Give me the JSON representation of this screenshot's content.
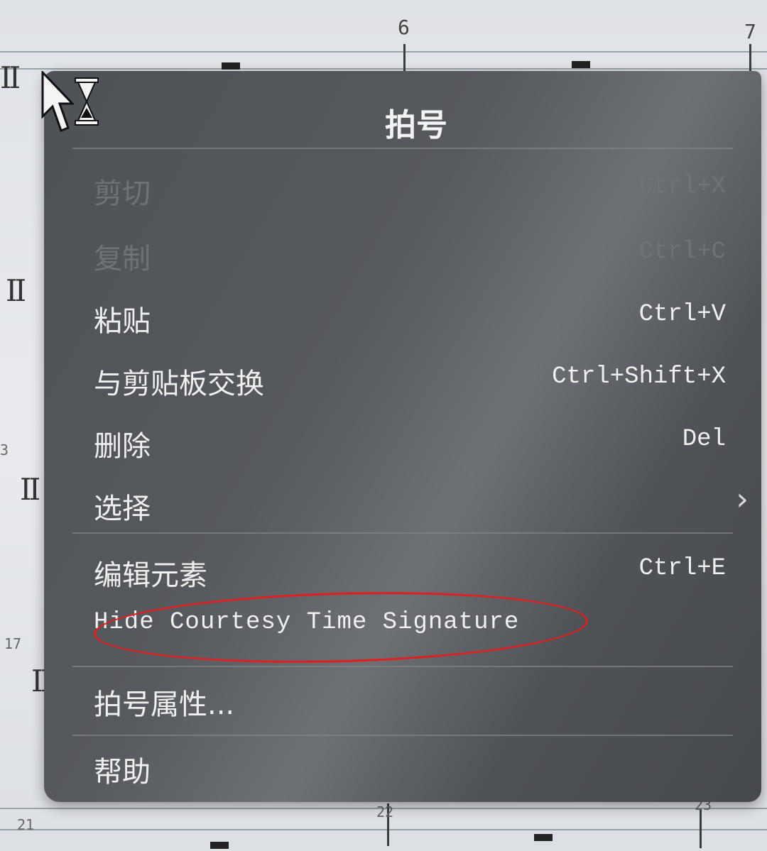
{
  "score": {
    "measure_numbers_top": [
      "6",
      "7"
    ],
    "measure_numbers_bottom": [
      "21",
      "22",
      "23"
    ],
    "left_margin_numbers": [
      "3",
      "17"
    ]
  },
  "menu": {
    "title": "拍号",
    "items": [
      {
        "label": "剪切",
        "shortcut": "Ctrl+X",
        "enabled": false
      },
      {
        "label": "复制",
        "shortcut": "Ctrl+C",
        "enabled": false
      },
      {
        "label": "粘贴",
        "shortcut": "Ctrl+V",
        "enabled": true
      },
      {
        "label": "与剪贴板交换",
        "shortcut": "Ctrl+Shift+X",
        "enabled": true
      },
      {
        "label": "删除",
        "shortcut": "Del",
        "enabled": true
      },
      {
        "label": "选择",
        "shortcut": "",
        "enabled": true,
        "submenu": true
      },
      {
        "label": "编辑元素",
        "shortcut": "Ctrl+E",
        "enabled": true
      },
      {
        "label": "Hide Courtesy Time Signature",
        "shortcut": "",
        "enabled": true
      },
      {
        "label": "拍号属性...",
        "shortcut": "",
        "enabled": true
      },
      {
        "label": "帮助",
        "shortcut": "",
        "enabled": true
      }
    ]
  },
  "icons": {
    "cursor": "arrow-pointer-icon",
    "busy": "hourglass-icon",
    "submenu": "chevron-right-icon"
  },
  "colors": {
    "menu_bg": "#55585c",
    "text": "#f0f0f0",
    "disabled_text": "#6f7277",
    "highlight": "#e02020"
  }
}
